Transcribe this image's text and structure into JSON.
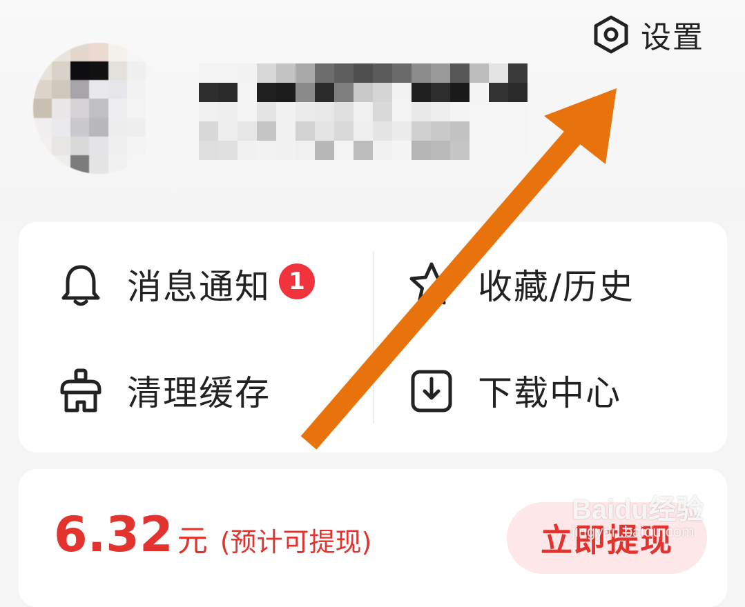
{
  "header": {
    "settings_label": "设置"
  },
  "menu": {
    "items": [
      {
        "label": "消息通知",
        "icon": "bell-icon",
        "badge": "1"
      },
      {
        "label": "收藏/历史",
        "icon": "star-icon"
      },
      {
        "label": "清理缓存",
        "icon": "broom-icon"
      },
      {
        "label": "下载中心",
        "icon": "download-icon"
      }
    ]
  },
  "earnings": {
    "amount": "6.32",
    "unit": "元",
    "note": "(预计可提现)",
    "withdraw_label": "立即提现"
  },
  "watermark": {
    "text": "Baidu经验",
    "sub": "jingyan.baidu.com"
  },
  "colors": {
    "accent_red": "#e3332e",
    "badge_red": "#f1333c",
    "annotation_arrow": "#e8730c"
  }
}
